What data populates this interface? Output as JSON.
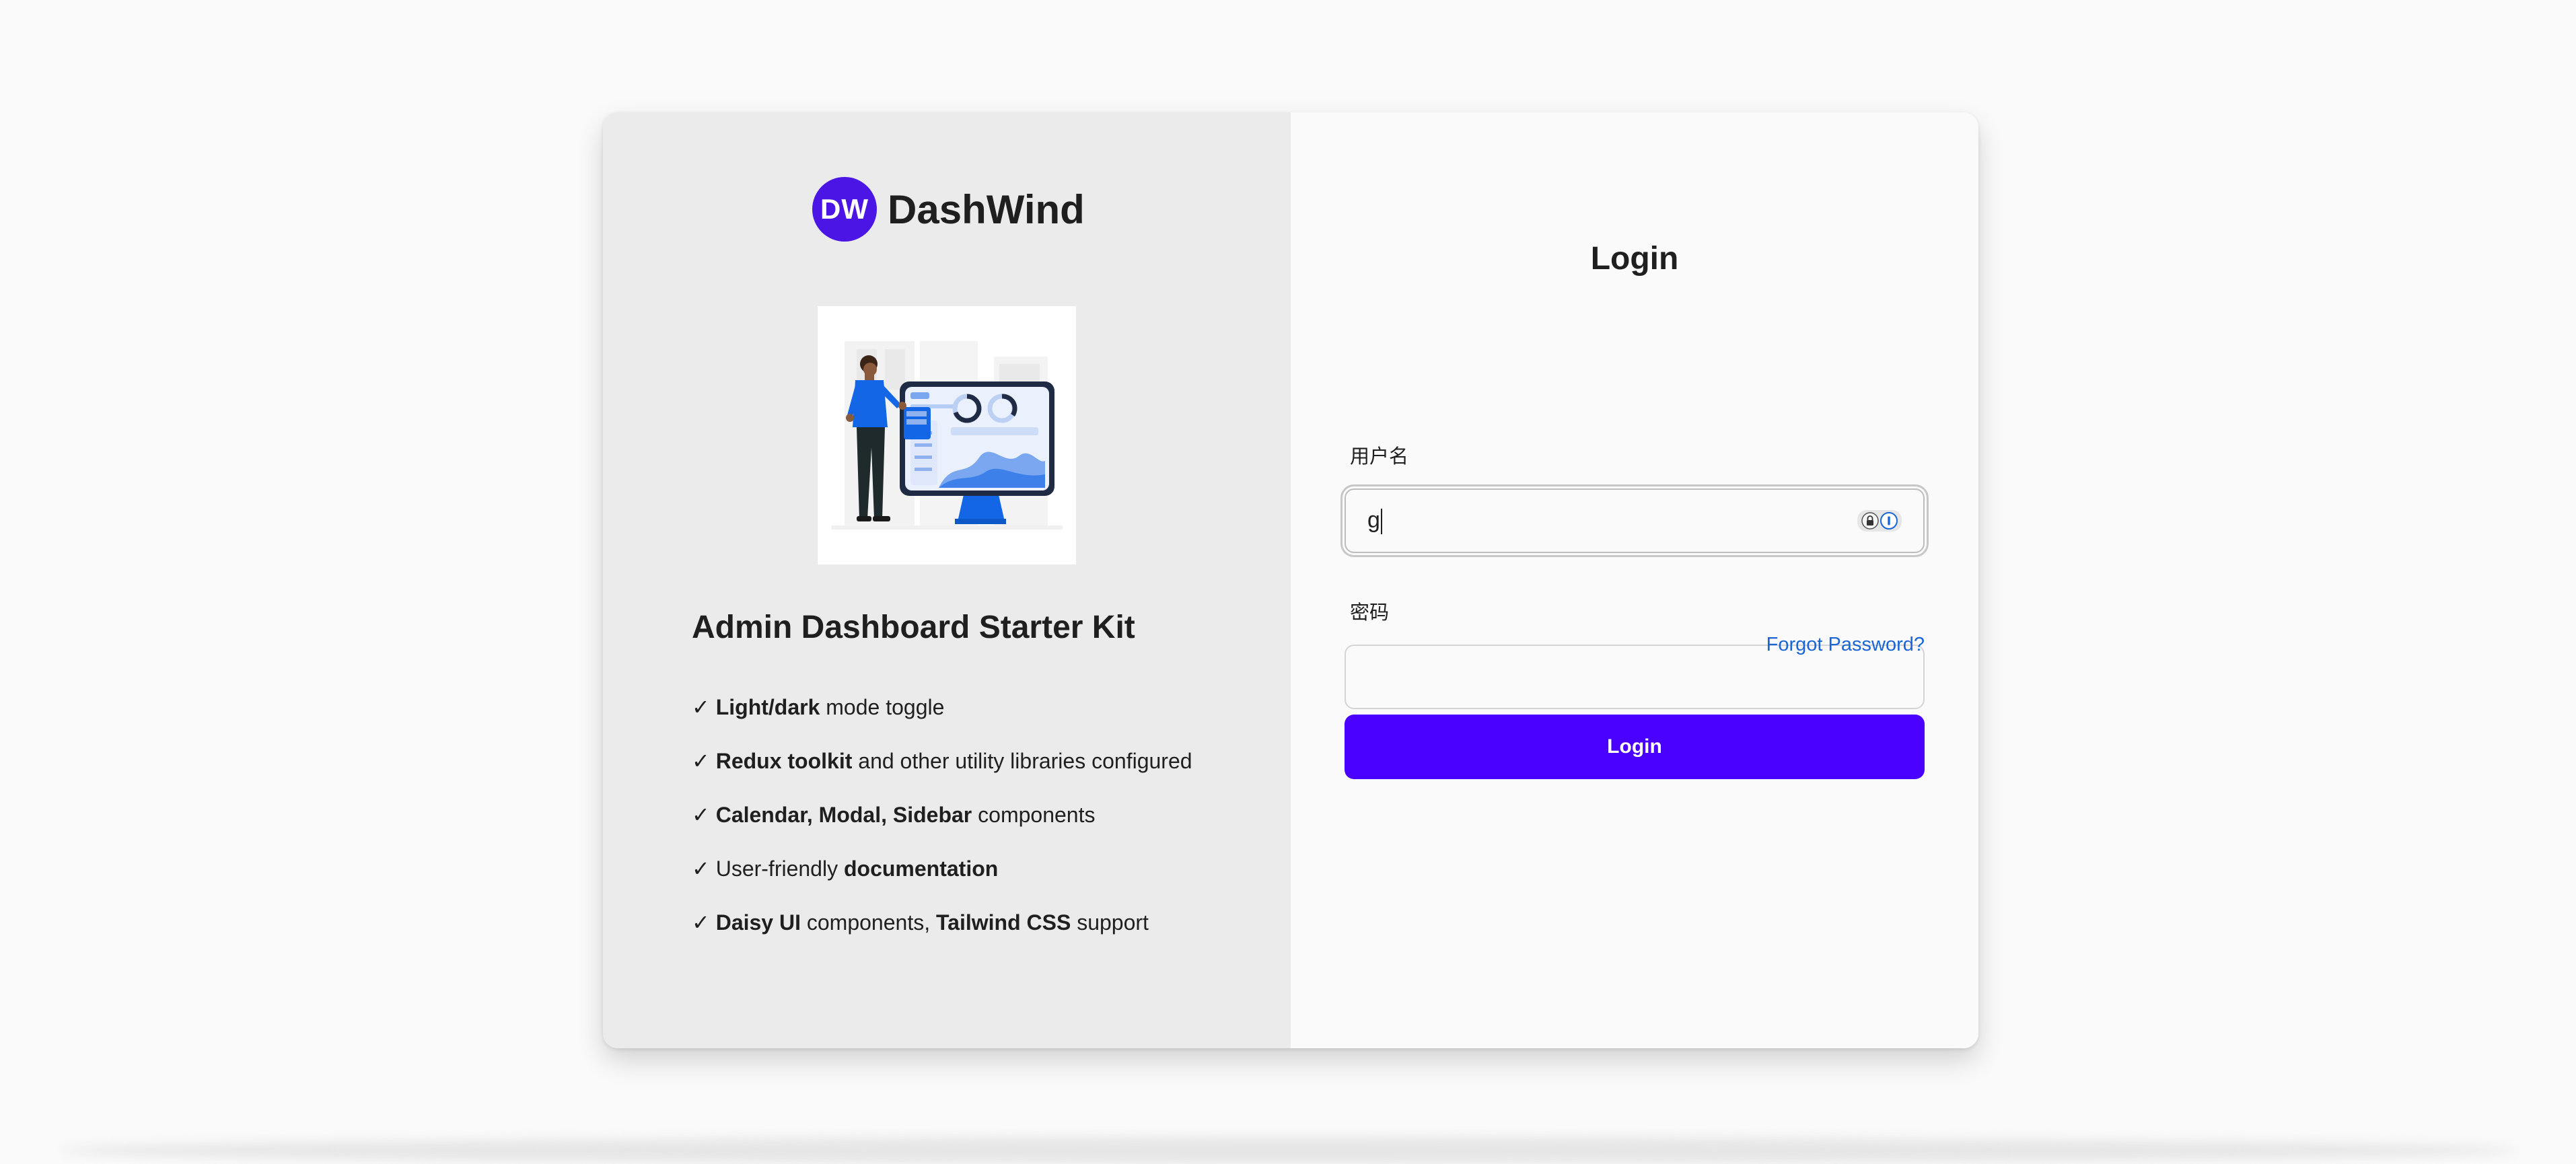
{
  "brand": {
    "logo_text": "DW",
    "name": "DashWind",
    "accent_color": "#4b16e5"
  },
  "hero": {
    "image": "person-presenting-dashboard-illustration"
  },
  "intro": {
    "title": "Admin Dashboard Starter Kit",
    "features": [
      {
        "check": "✓",
        "bold": "Light/dark",
        "text": " mode toggle"
      },
      {
        "check": "✓",
        "bold": "Redux toolkit",
        "text": " and other utility libraries configured"
      },
      {
        "check": "✓",
        "bold": "Calendar, Modal, Sidebar",
        "text": " components"
      },
      {
        "check": "✓",
        "pre": "User-friendly ",
        "bold": "documentation"
      },
      {
        "check": "✓",
        "bold": "Daisy UI",
        "text": " components, ",
        "bold2": "Tailwind CSS",
        "text2": " support"
      }
    ]
  },
  "login": {
    "title": "Login",
    "username_label": "用户名",
    "username_value": "g",
    "password_label": "密码",
    "password_value": "",
    "forgot_label": "Forgot Password?",
    "button_label": "Login",
    "button_color": "#4a00ff",
    "link_color": "#1a66d6"
  }
}
